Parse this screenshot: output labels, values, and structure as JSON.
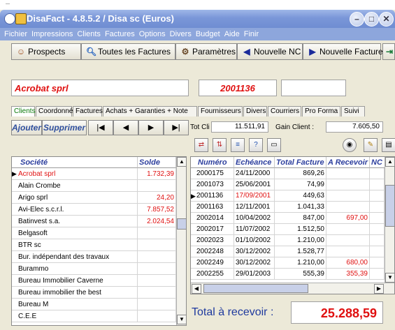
{
  "background_text": "...",
  "window": {
    "title": "DisaFact - 4.8.5.2 / Disa sc (Euros)",
    "controls": {
      "minimize": "–",
      "maximize": "□",
      "close": "✕"
    }
  },
  "menu": [
    "Fichier",
    "Impressions",
    "Clients",
    "Factures",
    "Options",
    "Divers",
    "Budget",
    "Aide",
    "Finir"
  ],
  "toolbar": {
    "prospects": "Prospects",
    "toutes_factures": "Toutes les Factures",
    "parametres": "Paramètres",
    "nouvelle_nc": "Nouvelle NC",
    "nouvelle_facture": "Nouvelle Facture"
  },
  "client": {
    "name": "Acrobat sprl",
    "number": "2001136",
    "extra": ""
  },
  "tabs": [
    "Clients",
    "Coordonnées",
    "Factures",
    "Achats + Garanties + Note",
    "Fournisseurs",
    "Divers",
    "Courriers",
    "Pro Forma",
    "Suivi"
  ],
  "nav": {
    "ajouter": "Ajouter",
    "supprimer": "Supprimer",
    "first": "|◀",
    "prev": "◀",
    "next": "▶",
    "last": "▶|"
  },
  "totals": {
    "tot_cli_label": "Tot Cli :",
    "tot_cli_value": "11.511,91",
    "gain_label": "Gain Client :",
    "gain_value": "7.605,50"
  },
  "clients_table": {
    "headers": {
      "societe": "Société",
      "solde": "Solde"
    },
    "selected_marker": "▶",
    "rows": [
      {
        "societe": "Acrobat sprl",
        "solde": "1.732,39"
      },
      {
        "societe": "Alain Crombe",
        "solde": ""
      },
      {
        "societe": "Arigo sprl",
        "solde": "24,20"
      },
      {
        "societe": "Avi-Elec s.c.r.l.",
        "solde": "7.857,52"
      },
      {
        "societe": "Batinvest s.a.",
        "solde": "2.024,54"
      },
      {
        "societe": "Belgasoft",
        "solde": ""
      },
      {
        "societe": "BTR sc",
        "solde": ""
      },
      {
        "societe": "Bur. indépendant des travaux",
        "solde": ""
      },
      {
        "societe": "Burammo",
        "solde": ""
      },
      {
        "societe": "Bureau Immobilier Caverne",
        "solde": ""
      },
      {
        "societe": "Bureau immobilier the best",
        "solde": ""
      },
      {
        "societe": "Bureau M",
        "solde": ""
      },
      {
        "societe": "C.E.E",
        "solde": ""
      }
    ]
  },
  "invoices_table": {
    "headers": {
      "numero": "Numéro",
      "echeance": "Echéance",
      "total": "Total Facture",
      "recevoir": "A Recevoir",
      "nc": "NC"
    },
    "rows": [
      {
        "numero": "2000175",
        "echeance": "24/11/2000",
        "total": "869,26",
        "recevoir": ""
      },
      {
        "numero": "2001073",
        "echeance": "25/06/2001",
        "total": "74,99",
        "recevoir": ""
      },
      {
        "numero": "2001136",
        "echeance": "17/09/2001",
        "total": "449,63",
        "recevoir": ""
      },
      {
        "numero": "2001163",
        "echeance": "12/11/2001",
        "total": "1.041,33",
        "recevoir": ""
      },
      {
        "numero": "2002014",
        "echeance": "10/04/2002",
        "total": "847,00",
        "recevoir": "697,00"
      },
      {
        "numero": "2002017",
        "echeance": "11/07/2002",
        "total": "1.512,50",
        "recevoir": ""
      },
      {
        "numero": "2002023",
        "echeance": "01/10/2002",
        "total": "1.210,00",
        "recevoir": ""
      },
      {
        "numero": "2002248",
        "echeance": "30/12/2002",
        "total": "1.528,77",
        "recevoir": ""
      },
      {
        "numero": "2002249",
        "echeance": "30/12/2002",
        "total": "1.210,00",
        "recevoir": "680,00"
      },
      {
        "numero": "2002255",
        "echeance": "29/01/2003",
        "total": "555,39",
        "recevoir": "355,39"
      }
    ]
  },
  "total_recevoir": {
    "label": "Total à recevoir :",
    "value": "25.288,59"
  },
  "colors": {
    "title_bar": "#7a96d8",
    "menu_bar": "#8da6dc",
    "accent_red": "#e01010",
    "header_blue": "#2d3f9e",
    "window_bg": "#ece9d8"
  }
}
